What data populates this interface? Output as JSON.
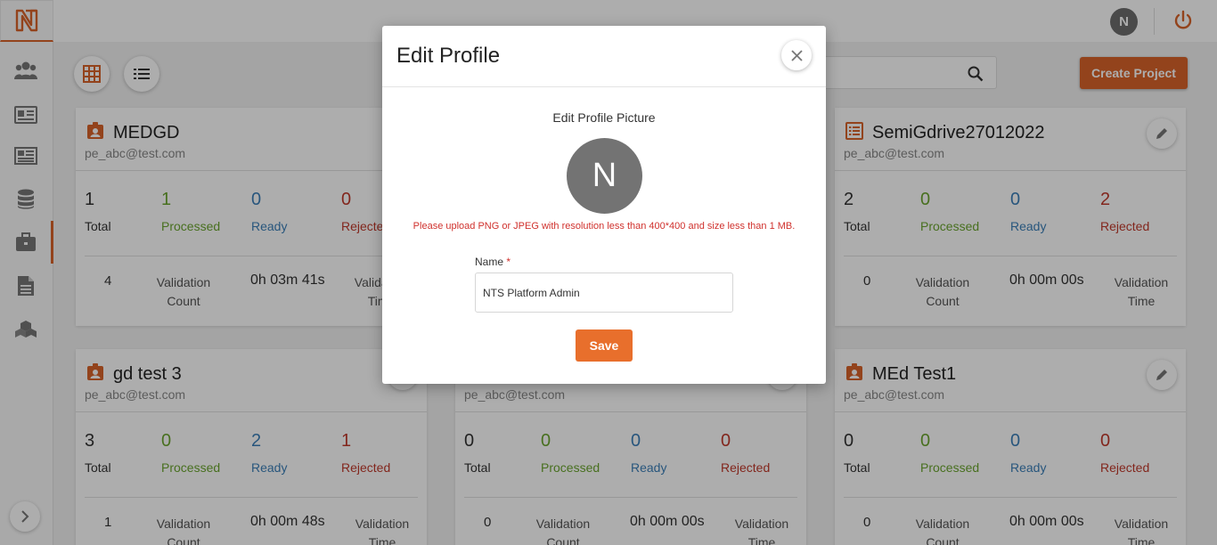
{
  "topbar": {
    "avatar_initial": "N"
  },
  "toolbar": {
    "create_label": "Create Project"
  },
  "stat_labels": {
    "total": "Total",
    "processed": "Processed",
    "ready": "Ready",
    "rejected": "Rejected",
    "validation_count": "Validation Count",
    "validation_time": "Validation Time"
  },
  "cards": [
    {
      "title": "MEDGD",
      "email": "pe_abc@test.com",
      "total": "1",
      "processed": "1",
      "ready": "0",
      "rejected": "0",
      "validation_count": "4",
      "validation_time": "0h 03m 41s"
    },
    {
      "title": "SemiGdrive27012022",
      "email": "pe_abc@test.com",
      "total": "2",
      "processed": "0",
      "ready": "0",
      "rejected": "2",
      "validation_count": "0",
      "validation_time": "0h 00m 00s"
    },
    {
      "title": "gd test 3",
      "email": "pe_abc@test.com",
      "total": "3",
      "processed": "0",
      "ready": "2",
      "rejected": "1",
      "validation_count": "1",
      "validation_time": "0h 00m 48s"
    },
    {
      "title": "",
      "email": "pe_abc@test.com",
      "total": "0",
      "processed": "0",
      "ready": "0",
      "rejected": "0",
      "validation_count": "0",
      "validation_time": "0h 00m 00s"
    },
    {
      "title": "MEd Test1",
      "email": "pe_abc@test.com",
      "total": "0",
      "processed": "0",
      "ready": "0",
      "rejected": "0",
      "validation_count": "0",
      "validation_time": "0h 00m 00s"
    }
  ],
  "modal": {
    "title": "Edit Profile",
    "picture_label": "Edit Profile Picture",
    "avatar_initial": "N",
    "upload_note": "Please upload PNG or JPEG with resolution less than 400*400 and size less than 1 MB.",
    "name_label": "Name",
    "required_mark": "*",
    "name_value": "NTS Platform Admin",
    "save_label": "Save"
  },
  "colors": {
    "accent": "#d9632a",
    "processed": "#6aa52f",
    "ready": "#3b7fb8",
    "rejected": "#c0392b"
  }
}
